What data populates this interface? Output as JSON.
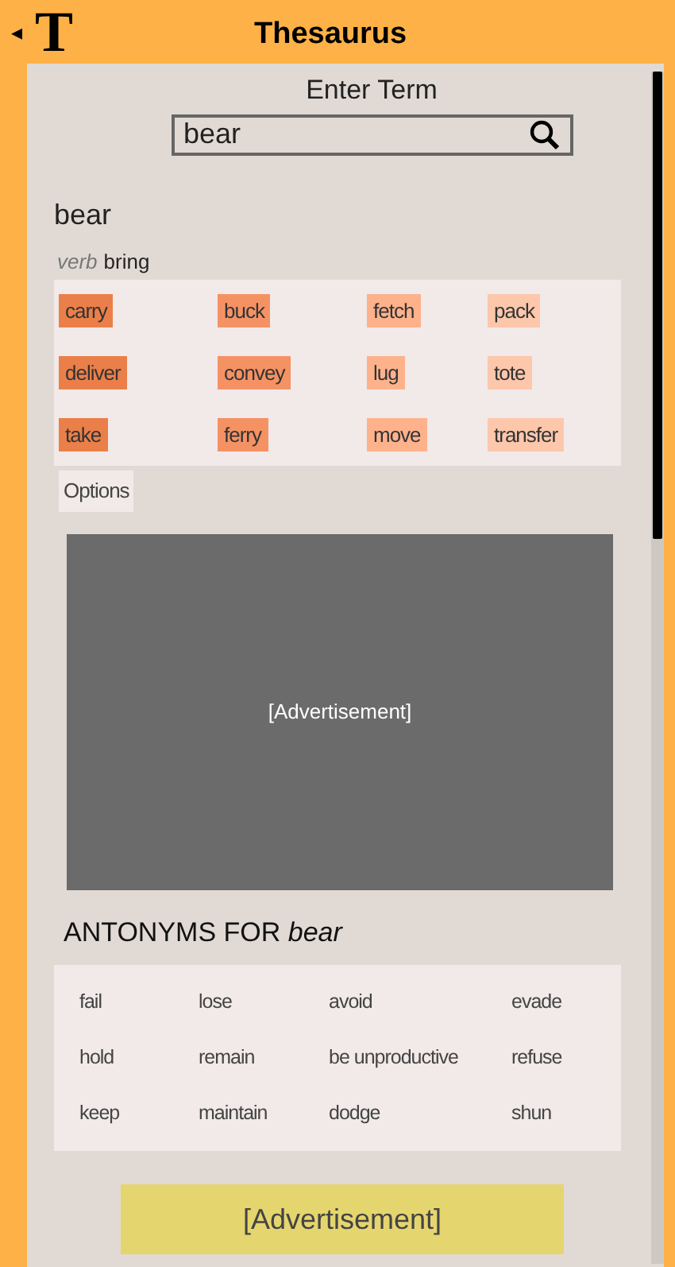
{
  "header": {
    "back_glyph": "◂",
    "logo": "T",
    "title": "Thesaurus"
  },
  "search": {
    "label": "Enter Term",
    "value": "bear"
  },
  "entry": {
    "word": "bear",
    "part_of_speech": "verb",
    "sense": "bring"
  },
  "synonyms": [
    {
      "text": "carry",
      "color": "#eb7f49"
    },
    {
      "text": "buck",
      "color": "#f59264"
    },
    {
      "text": "fetch",
      "color": "#fdb28c"
    },
    {
      "text": "pack",
      "color": "#fcc7ab"
    },
    {
      "text": "deliver",
      "color": "#eb7f49"
    },
    {
      "text": "convey",
      "color": "#f59264"
    },
    {
      "text": "lug",
      "color": "#fdb28c"
    },
    {
      "text": "tote",
      "color": "#fcc7ab"
    },
    {
      "text": "take",
      "color": "#eb7f49"
    },
    {
      "text": "ferry",
      "color": "#f59264"
    },
    {
      "text": "move",
      "color": "#fdb28c"
    },
    {
      "text": "transfer",
      "color": "#fcc7ab"
    }
  ],
  "options_button": "Options",
  "ad_large": "[Advertisement]",
  "antonyms_heading": "ANTONYMS FOR *bear*",
  "antonyms": [
    "fail",
    "lose",
    "avoid",
    "evade",
    "hold",
    "remain",
    "be unproductive",
    "refuse",
    "keep",
    "maintain",
    "dodge",
    "shun"
  ],
  "ad_banner": "[Advertisement]"
}
